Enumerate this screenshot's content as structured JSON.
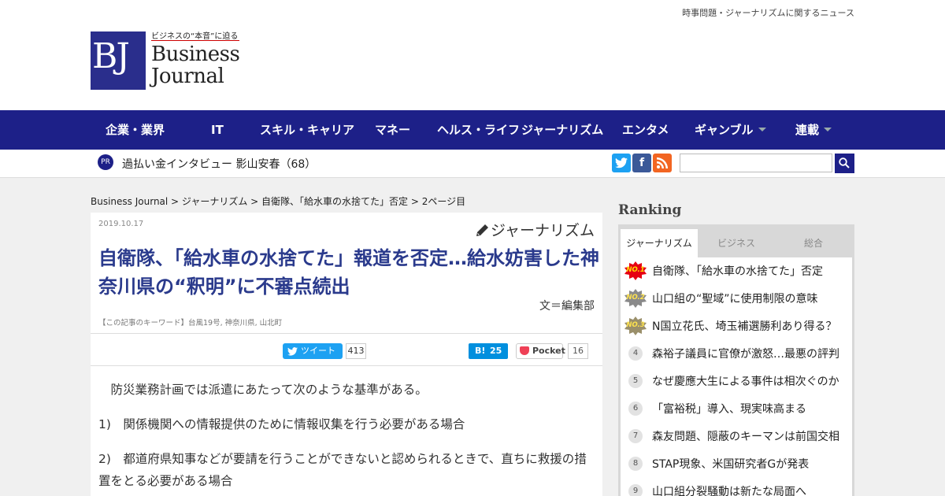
{
  "header": {
    "tagline": "時事問題・ジャーナリズムに関するニュース",
    "logo_sub": "ビジネスの“本音”に迫る",
    "logo_mark": "BJ",
    "logo_line1": "Business",
    "logo_line2": "Journal"
  },
  "nav": {
    "items": [
      {
        "label": "企業・業界"
      },
      {
        "label": "IT"
      },
      {
        "label": "スキル・キャリア"
      },
      {
        "label": "マネー"
      },
      {
        "label": "ヘルス・ライフ"
      },
      {
        "label": "ジャーナリズム"
      },
      {
        "label": "エンタメ"
      },
      {
        "label": "ギャンブル"
      },
      {
        "label": "連載"
      }
    ]
  },
  "subbar": {
    "pr_badge": "PR",
    "pr_text": "過払い金インタビュー 影山安春（68）",
    "sns": [
      "twitter-icon",
      "facebook-icon",
      "rss-icon"
    ],
    "search_value": ""
  },
  "breadcrumb": {
    "home": "Business Journal",
    "sep": " > ",
    "category": "ジャーナリズム",
    "article": "自衛隊、「給水車の水捨てた」否定",
    "page": "2ページ目"
  },
  "article": {
    "date": "2019.10.17",
    "category": "ジャーナリズム",
    "title": "自衛隊、「給水車の水捨てた」報道を否定…給水妨害した神奈川県の“釈明”に不審点続出",
    "author": "文＝編集部",
    "keywords": "【この記事のキーワード】台風19号, 神奈川県, 山北町",
    "share": {
      "tweet_label": "ツイート",
      "tweet_count": "413",
      "hatena_count": "25",
      "pocket_label": "Pocket",
      "pocket_count": "16"
    },
    "paragraphs": [
      "　防災業務計画では派遣にあたって次のような基準がある。",
      "1)　関係機関への情報提供のために情報収集を行う必要がある場合",
      "2)　都道府県知事などが要請を行うことができないと認められるときで、直ちに救援の措置をとる必要がある場合"
    ]
  },
  "ranking": {
    "title": "Ranking",
    "tabs": [
      "ジャーナリズム",
      "ビジネス",
      "総合"
    ],
    "active_tab": "ジャーナリズム",
    "items": [
      {
        "rank": "NO.1",
        "title": "自衛隊、「給水車の水捨てた」否定"
      },
      {
        "rank": "NO.2",
        "title": "山口組の“聖域”に使用制限の意味"
      },
      {
        "rank": "NO.3",
        "title": "N国立花氏、埼玉補選勝利あり得る？"
      },
      {
        "rank": "4",
        "title": "森裕子議員に官僚が激怒…最悪の評判"
      },
      {
        "rank": "5",
        "title": "なぜ慶應大生による事件は相次ぐのか"
      },
      {
        "rank": "6",
        "title": "「富裕税」導入、現実味高まる"
      },
      {
        "rank": "7",
        "title": "森友問題、隠蔽のキーマンは前国交相"
      },
      {
        "rank": "8",
        "title": "STAP現象、米国研究者Gが発表"
      },
      {
        "rank": "9",
        "title": "山口組分裂騒動は新たな局面へ"
      }
    ]
  },
  "colors": {
    "brand_navy": "#1d2088",
    "title_blue": "#2a3a8c",
    "twitter": "#1da1f2",
    "hatena": "#008fde",
    "pocket": "#ef4056"
  }
}
